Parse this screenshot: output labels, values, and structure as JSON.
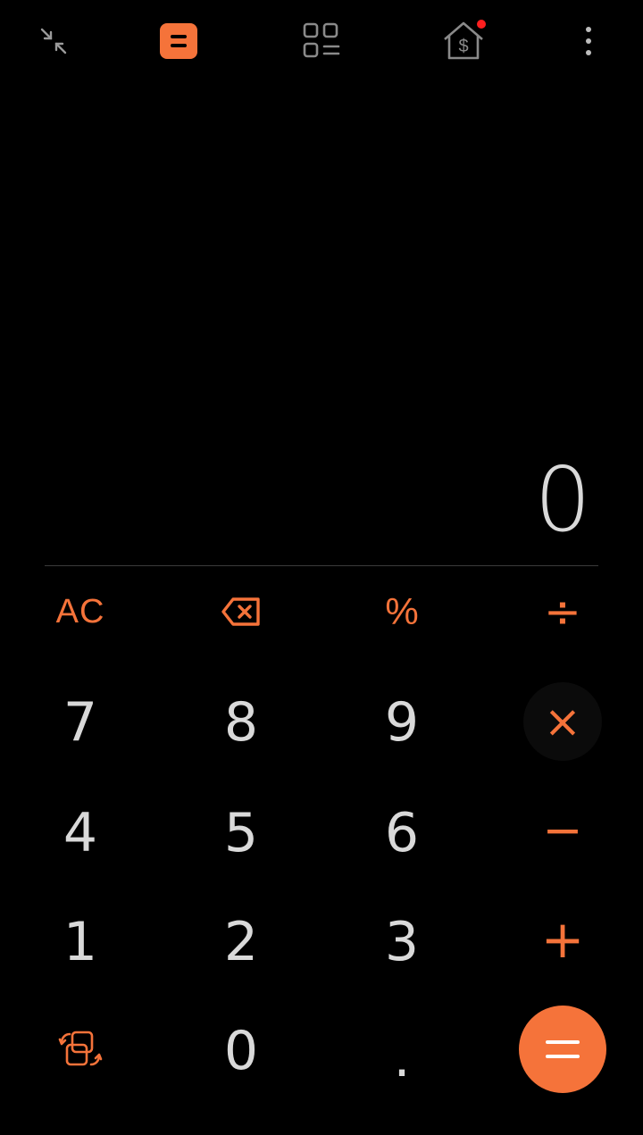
{
  "colors": {
    "accent": "#f5733a",
    "background": "#000000",
    "digit": "#d9d9d9",
    "notification_dot": "#ff1f1f"
  },
  "toolbar": {
    "icons": [
      "collapse-icon",
      "calculator-icon",
      "converter-icon",
      "mortgage-icon",
      "more-options-icon"
    ]
  },
  "display": {
    "value": "0"
  },
  "keypad": {
    "ac": "AC",
    "backspace_icon": "backspace-icon",
    "percent": "%",
    "divide": "÷",
    "multiply": "×",
    "minus": "−",
    "plus": "+",
    "equals": "=",
    "seven": "7",
    "eight": "8",
    "nine": "9",
    "four": "4",
    "five": "5",
    "six": "6",
    "one": "1",
    "two": "2",
    "three": "3",
    "zero": "0",
    "dot": ".",
    "switch_mode_icon": "switch-mode-icon"
  }
}
